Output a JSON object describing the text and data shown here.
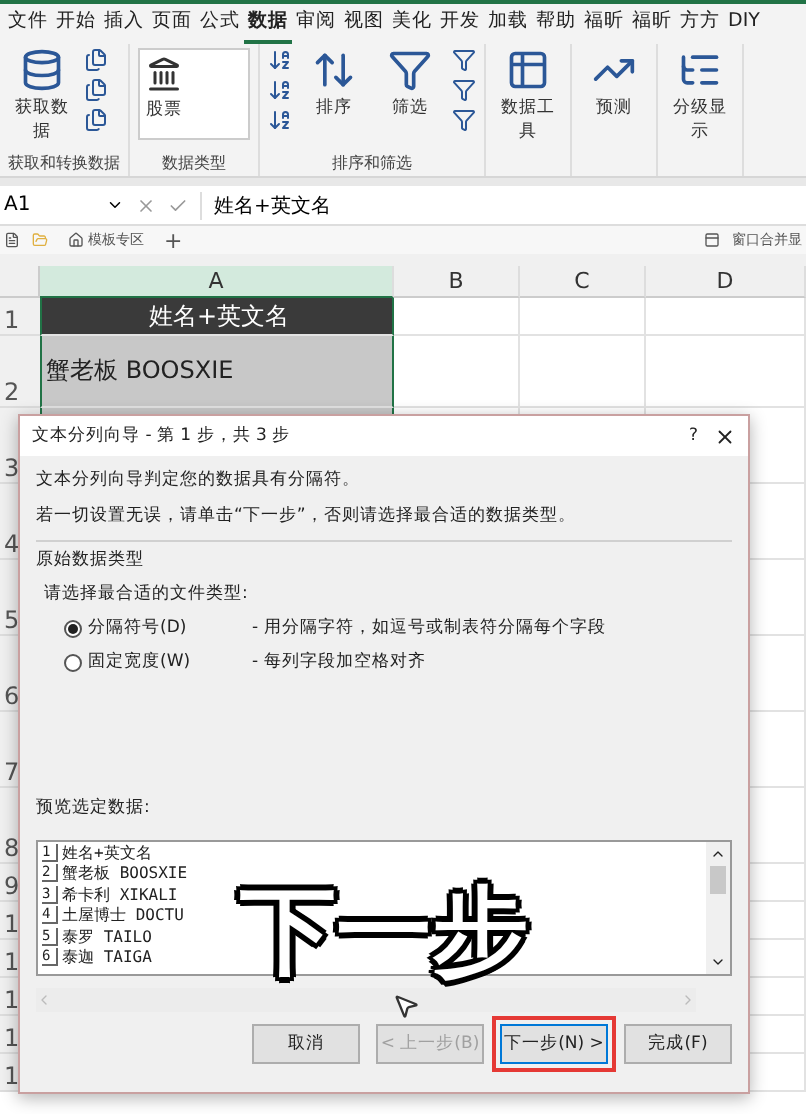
{
  "ribbon_tabs": [
    {
      "label": "文件",
      "selected": false
    },
    {
      "label": "开始",
      "selected": false
    },
    {
      "label": "插入",
      "selected": false
    },
    {
      "label": "页面",
      "selected": false
    },
    {
      "label": "公式",
      "selected": false
    },
    {
      "label": "数据",
      "selected": true
    },
    {
      "label": "审阅",
      "selected": false
    },
    {
      "label": "视图",
      "selected": false
    },
    {
      "label": "美化",
      "selected": false
    },
    {
      "label": "开发",
      "selected": false
    },
    {
      "label": "加载",
      "selected": false
    },
    {
      "label": "帮助",
      "selected": false
    },
    {
      "label": "福昕",
      "selected": false
    },
    {
      "label": "福昕",
      "selected": false
    },
    {
      "label": "方方",
      "selected": false
    },
    {
      "label": "DIY",
      "selected": false
    }
  ],
  "ribbon_groups": [
    {
      "label": "获取和转换数据",
      "buttons": [
        {
          "kind": "get-data",
          "label": "获取数据"
        },
        {
          "kind": "file-stack"
        }
      ]
    },
    {
      "label": "数据类型",
      "buttons": [
        {
          "kind": "gallery",
          "label": "股票"
        }
      ]
    },
    {
      "label": "排序和筛选",
      "buttons": [
        {
          "kind": "sort-stack"
        },
        {
          "kind": "sort",
          "label": "排序"
        },
        {
          "kind": "filter",
          "label": "筛选"
        },
        {
          "kind": "filter-stack"
        }
      ]
    },
    {
      "buttons": [
        {
          "kind": "tools",
          "label": "数据工具"
        }
      ]
    },
    {
      "buttons": [
        {
          "kind": "forecast",
          "label": "预测"
        }
      ]
    },
    {
      "buttons": [
        {
          "kind": "outline",
          "label": "分级显示"
        }
      ]
    }
  ],
  "formula_bar": {
    "name_box": "A1",
    "formula": "姓名+英文名"
  },
  "sheet_bar": {
    "tabs": [
      {
        "label": "模板专区"
      }
    ],
    "add": "+",
    "right_label": "窗口合并显"
  },
  "columns": [
    {
      "label": "A",
      "selected": true
    },
    {
      "label": "B",
      "selected": false
    },
    {
      "label": "C",
      "selected": false
    },
    {
      "label": "D",
      "selected": false
    }
  ],
  "rows": [
    {
      "number": "1",
      "kind": "header",
      "cell": "姓名+英文名"
    },
    {
      "number": "2",
      "kind": "data",
      "cell": "蟹老板 BOOSXIE"
    },
    {
      "number": "3",
      "kind": "blank"
    },
    {
      "number": "4",
      "kind": "blank"
    },
    {
      "number": "5",
      "kind": "blank"
    },
    {
      "number": "6",
      "kind": "blank"
    },
    {
      "number": "7",
      "kind": "blank"
    },
    {
      "number": "8",
      "kind": "blank"
    },
    {
      "number": "9",
      "kind": "short"
    },
    {
      "number": "1",
      "kind": "short"
    },
    {
      "number": "1",
      "kind": "short"
    },
    {
      "number": "1",
      "kind": "short"
    },
    {
      "number": "1",
      "kind": "short"
    },
    {
      "number": "1",
      "kind": "short"
    }
  ],
  "dialog": {
    "title": "文本分列向导 - 第 1 步，共 3 步",
    "help": "?",
    "intro": [
      "文本分列向导判定您的数据具有分隔符。",
      "若一切设置无误，请单击“下一步”，否则请选择最合适的数据类型。"
    ],
    "group_label": "原始数据类型",
    "prompt": "请选择最合适的文件类型:",
    "file_types": [
      {
        "label": "分隔符号(D)",
        "description": "- 用分隔字符，如逗号或制表符分隔每个字段",
        "selected": true
      },
      {
        "label": "固定宽度(W)",
        "description": "- 每列字段加空格对齐",
        "selected": false
      }
    ],
    "preview_label": "预览选定数据:",
    "preview_lines": [
      {
        "number": "1",
        "text": "姓名+英文名"
      },
      {
        "number": "2",
        "text": "蟹老板 BOOSXIE"
      },
      {
        "number": "3",
        "text": "希卡利 XIKALI"
      },
      {
        "number": "4",
        "text": "土屋博士 DOCTU"
      },
      {
        "number": "5",
        "text": "泰罗 TAILO"
      },
      {
        "number": "6",
        "text": "泰迦 TAIGA"
      }
    ],
    "buttons": [
      {
        "label": "取消",
        "disabled": false,
        "highlighted": false
      },
      {
        "label": "< 上一步(B)",
        "disabled": true,
        "highlighted": false
      },
      {
        "label": "下一步(N) >",
        "disabled": false,
        "highlighted": true
      },
      {
        "label": "完成(F)",
        "disabled": false,
        "highlighted": false
      }
    ]
  },
  "caption": "下一步"
}
